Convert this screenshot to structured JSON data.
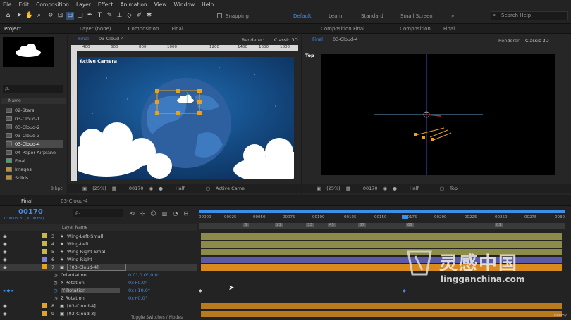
{
  "menu": [
    "File",
    "Edit",
    "Composition",
    "Layer",
    "Effect",
    "Animation",
    "View",
    "Window",
    "Help"
  ],
  "toolbar": {
    "snapping": "Snapping",
    "workspaces": [
      "Default",
      "Learn",
      "Standard",
      "Small Screen"
    ],
    "search_placeholder": "Search Help",
    "more": "»"
  },
  "project": {
    "tab": "Project",
    "search": "ρ.",
    "col_name": "Name",
    "items": [
      "02-Stars",
      "03-Cloud-1",
      "03-Cloud-2",
      "03-Cloud-3",
      "03-Cloud-4",
      "04-Paper Airplane",
      "Final",
      "Images",
      "Solids"
    ],
    "selected_index": 4,
    "bpc": "8 bpc"
  },
  "comp_left": {
    "tabs": [
      "Layer (none)",
      "Composition"
    ],
    "comp_name": "Final",
    "flow": [
      "Final",
      "03-Cloud-4"
    ],
    "renderer_label": "Renderer:",
    "renderer": "Classic 3D",
    "view_label": "Active Camera",
    "zoom": "(25%)",
    "timecode": "00170",
    "quality": "Half",
    "camera": "Active Came"
  },
  "comp_right": {
    "tabs": [
      "Composition Final",
      "Composition"
    ],
    "comp_name": "Final",
    "flow": [
      "Final",
      "03-Cloud-4"
    ],
    "renderer_label": "Renderer:",
    "renderer": "Classic 3D",
    "view_label": "Top",
    "zoom": "(25%)",
    "timecode": "00170",
    "quality": "Half",
    "view": "Top"
  },
  "ruler": [
    "400",
    "600",
    "800",
    "1000",
    "1200",
    "1400",
    "1600",
    "1800"
  ],
  "timeline": {
    "tabs": [
      "Final",
      "03-Cloud-4"
    ],
    "timecode": "00170",
    "timecode_sub": "0:00:05:20 (30.00 fps)",
    "col_layer_name": "Layer Name",
    "layers": [
      {
        "num": "3",
        "name": "Wing-Left-Small",
        "color": "#c8b840",
        "star": true
      },
      {
        "num": "4",
        "name": "Wing-Left",
        "color": "#c8b840",
        "star": true
      },
      {
        "num": "5",
        "name": "Wing-Right-Small",
        "color": "#c8b840",
        "star": true
      },
      {
        "num": "6",
        "name": "Wing-Right",
        "color": "#8080e0",
        "star": true
      },
      {
        "num": "7",
        "name": "[03-Cloud-4]",
        "color": "#e8a020",
        "star": false
      }
    ],
    "props": [
      {
        "name": "Orientation",
        "value": "0.0°,0.0°,0.0°"
      },
      {
        "name": "X Rotation",
        "value": "0x+0.0°"
      },
      {
        "name": "Y Rotation",
        "value": "0x+10.0°"
      },
      {
        "name": "Z Rotation",
        "value": "0x+0.0°"
      }
    ],
    "after": [
      {
        "num": "8",
        "name": "[03-Cloud-4]",
        "color": "#e8a020"
      },
      {
        "num": "9",
        "name": "[03-Cloud-3]",
        "color": "#e8a020"
      }
    ],
    "toggle": "Toggle Switches / Modes",
    "ticks": [
      "00000",
      "00025",
      "00050",
      "00075",
      "00100",
      "00125",
      "00150",
      "00175",
      "00200",
      "00225",
      "00250",
      "00275",
      "0030"
    ],
    "markers": [
      "6",
      "21",
      "33",
      "45",
      "57",
      "69",
      "81"
    ]
  },
  "watermark": {
    "cn": "灵感中国",
    "url": "lingganchina.com",
    "udemy": "Udemy"
  },
  "colors": {
    "accent": "#3c8ee8",
    "gold": "#e8a020",
    "bar_olive": "#8c8c48",
    "bar_blue": "#5a5aa8",
    "bar_orange": "#d88a1c"
  }
}
